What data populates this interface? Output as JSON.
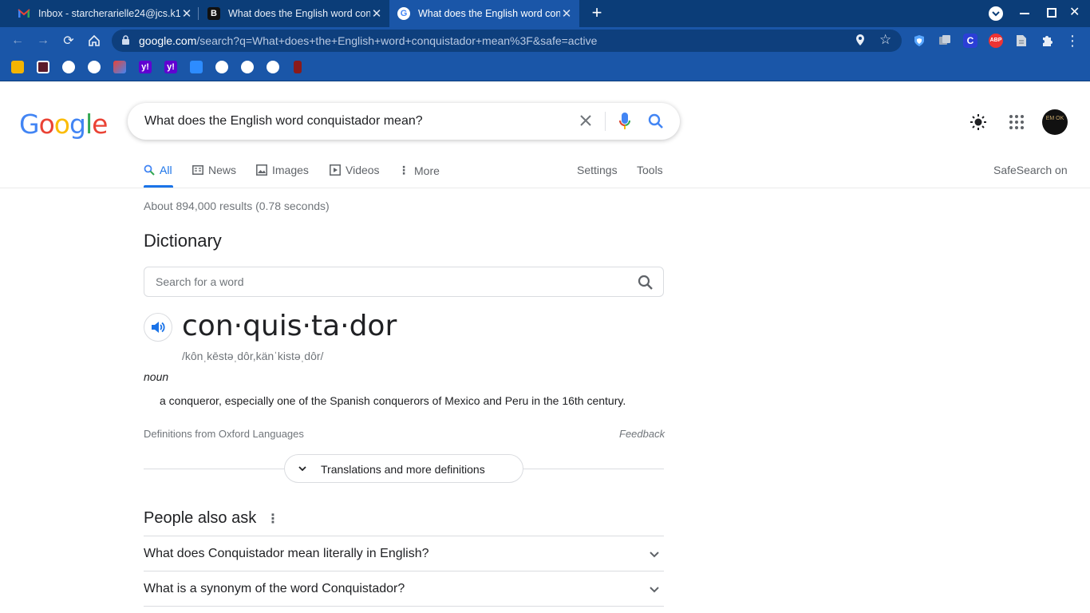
{
  "tabs": [
    {
      "title": "Inbox - starcherarielle24@jcs.k12",
      "favicon": "gmail-icon",
      "active": false
    },
    {
      "title": "What does the English word con",
      "favicon": "b-icon",
      "active": false
    },
    {
      "title": "What does the English word con",
      "favicon": "google-icon",
      "active": true
    }
  ],
  "toolbar": {
    "url_domain": "google.com",
    "url_path": "/search?q=What+does+the+English+word+conquistador+mean%3F&safe=active"
  },
  "search": {
    "query": "What does the English word conquistador mean?"
  },
  "nav": {
    "all": "All",
    "news": "News",
    "images": "Images",
    "videos": "Videos",
    "more": "More",
    "settings": "Settings",
    "tools": "Tools",
    "safesearch": "SafeSearch on"
  },
  "avatar": {
    "text": "EM OK"
  },
  "results": {
    "stats": "About 894,000 results (0.78 seconds)"
  },
  "dictionary": {
    "heading": "Dictionary",
    "search_placeholder": "Search for a word",
    "word": "con·quis·ta·dor",
    "phonetic": "/kônˌkēstəˌdôr,känˈkistəˌdôr/",
    "pos": "noun",
    "definition": "a conqueror, especially one of the Spanish conquerors of Mexico and Peru in the 16th century.",
    "source": "Definitions from Oxford Languages",
    "feedback": "Feedback",
    "more_button": "Translations and more definitions"
  },
  "people_also_ask": {
    "heading": "People also ask",
    "questions": [
      "What does Conquistador mean literally in English?",
      "What is a synonym of the word Conquistador?"
    ]
  },
  "colors": {
    "tab_bar": "#0b3d78",
    "toolbar": "#1a56a8",
    "google_blue": "#1a73e8"
  }
}
